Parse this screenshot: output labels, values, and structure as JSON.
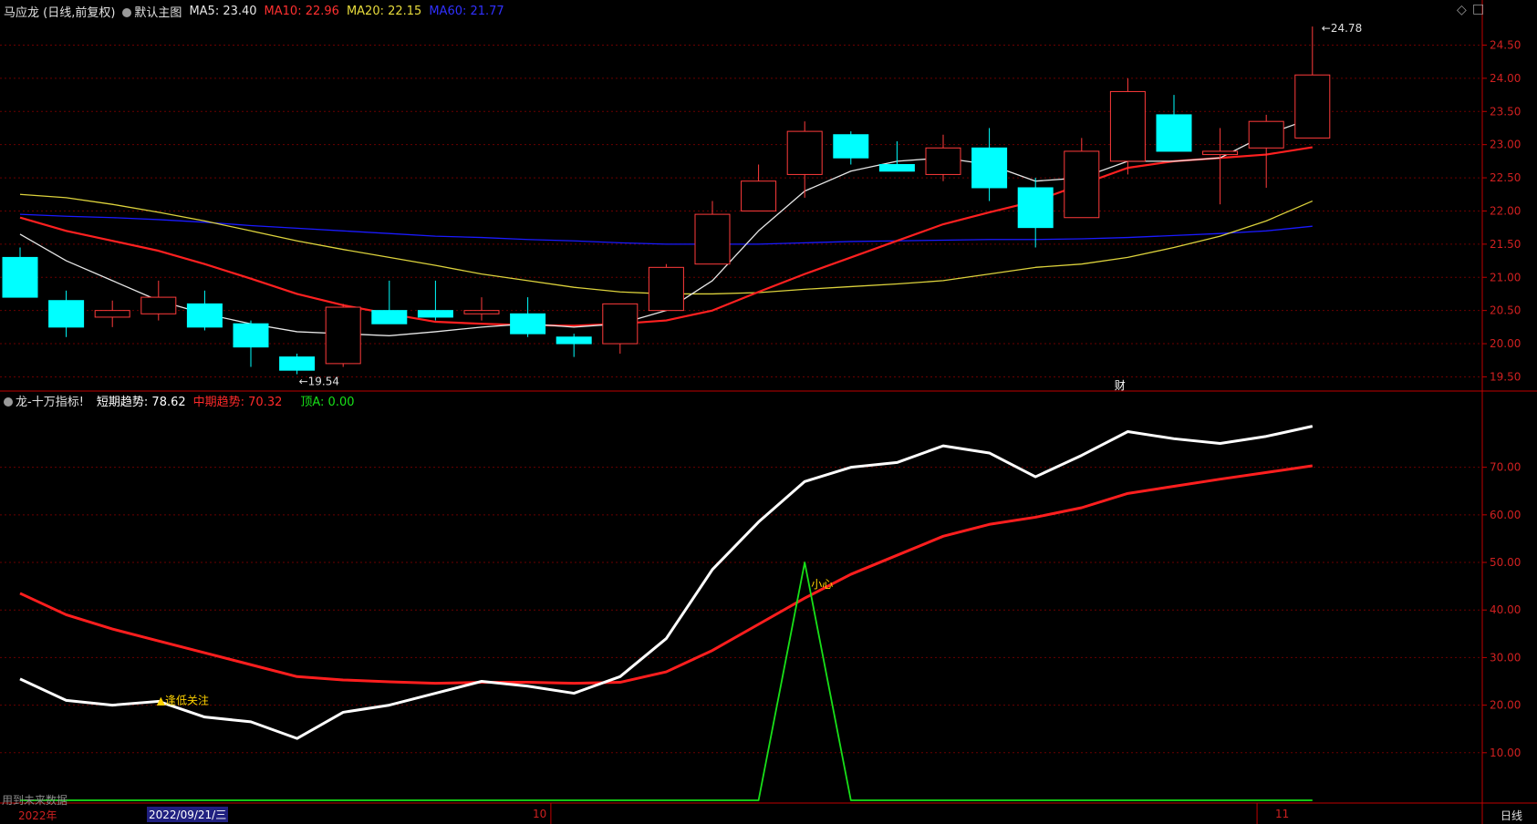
{
  "upper_header": {
    "title": "马应龙 (日线,前复权)",
    "main_chart": "默认主图",
    "ma5": "MA5: 23.40",
    "ma10": "MA10: 22.96",
    "ma20": "MA20: 22.15",
    "ma60": "MA60: 21.77"
  },
  "lower_header": {
    "title": "龙-十万指标!",
    "short": "短期趋势: 78.62",
    "mid": "中期趋势: 70.32",
    "top": "顶A: 0.00"
  },
  "colors": {
    "background": "#000000",
    "up": "#ff3b3b",
    "down": "#00ffff",
    "ma5": "#e6e6e6",
    "ma10": "#ff2020",
    "ma20": "#dcd23c",
    "ma60": "#1a1aff",
    "short_trend": "#ffffff",
    "mid_trend": "#ff1e1e",
    "top_a": "#18e018",
    "axis": "#c00000",
    "grid": "#6a0000"
  },
  "footer": {
    "future_data_note": "用到未来数据",
    "year_label": "2022年",
    "cursor_date": "2022/09/21/三",
    "month_oct": "10",
    "month_nov": "11",
    "period": "日线"
  },
  "controls": {
    "diamond_icon": "◇",
    "box_icon": "□"
  },
  "chart_data": [
    {
      "type": "candlestick",
      "title": "马应龙 (日线,前复权)",
      "y_ticks": [
        19.5,
        20.0,
        20.5,
        21.0,
        21.5,
        22.0,
        22.5,
        23.0,
        23.5,
        24.0,
        24.5
      ],
      "ylim": [
        19.3,
        24.85
      ],
      "candles": [
        {
          "o": 21.3,
          "h": 21.45,
          "l": 20.7,
          "c": 20.7
        },
        {
          "o": 20.65,
          "h": 20.8,
          "l": 20.1,
          "c": 20.25
        },
        {
          "o": 20.4,
          "h": 20.65,
          "l": 20.25,
          "c": 20.5
        },
        {
          "o": 20.45,
          "h": 20.95,
          "l": 20.35,
          "c": 20.7
        },
        {
          "o": 20.6,
          "h": 20.8,
          "l": 20.2,
          "c": 20.25
        },
        {
          "o": 20.3,
          "h": 20.35,
          "l": 19.65,
          "c": 19.95
        },
        {
          "o": 19.8,
          "h": 19.85,
          "l": 19.54,
          "c": 19.6
        },
        {
          "o": 19.7,
          "h": 20.6,
          "l": 19.65,
          "c": 20.55
        },
        {
          "o": 20.5,
          "h": 20.95,
          "l": 20.3,
          "c": 20.3
        },
        {
          "o": 20.5,
          "h": 20.95,
          "l": 20.35,
          "c": 20.4
        },
        {
          "o": 20.45,
          "h": 20.7,
          "l": 20.35,
          "c": 20.5
        },
        {
          "o": 20.45,
          "h": 20.7,
          "l": 20.1,
          "c": 20.15
        },
        {
          "o": 20.1,
          "h": 20.15,
          "l": 19.8,
          "c": 20.0
        },
        {
          "o": 20.0,
          "h": 20.55,
          "l": 19.85,
          "c": 20.6
        },
        {
          "o": 20.5,
          "h": 21.2,
          "l": 20.5,
          "c": 21.15
        },
        {
          "o": 21.2,
          "h": 22.15,
          "l": 21.2,
          "c": 21.95
        },
        {
          "o": 22.0,
          "h": 22.7,
          "l": 22.0,
          "c": 22.45
        },
        {
          "o": 22.55,
          "h": 23.35,
          "l": 22.2,
          "c": 23.2
        },
        {
          "o": 23.15,
          "h": 23.2,
          "l": 22.7,
          "c": 22.8
        },
        {
          "o": 22.7,
          "h": 23.05,
          "l": 22.6,
          "c": 22.6
        },
        {
          "o": 22.55,
          "h": 23.15,
          "l": 22.45,
          "c": 22.95
        },
        {
          "o": 22.95,
          "h": 23.25,
          "l": 22.15,
          "c": 22.35
        },
        {
          "o": 22.35,
          "h": 22.5,
          "l": 21.45,
          "c": 21.75
        },
        {
          "o": 21.9,
          "h": 23.1,
          "l": 21.9,
          "c": 22.9
        },
        {
          "o": 22.75,
          "h": 24.0,
          "l": 22.55,
          "c": 23.8
        },
        {
          "o": 23.45,
          "h": 23.75,
          "l": 22.9,
          "c": 22.9
        },
        {
          "o": 22.85,
          "h": 23.25,
          "l": 22.1,
          "c": 22.9
        },
        {
          "o": 22.95,
          "h": 23.45,
          "l": 22.35,
          "c": 23.35
        },
        {
          "o": 23.1,
          "h": 24.78,
          "l": 23.1,
          "c": 24.05
        }
      ],
      "ma5": [
        21.65,
        21.25,
        20.95,
        20.65,
        20.45,
        20.3,
        20.18,
        20.15,
        20.12,
        20.18,
        20.25,
        20.3,
        20.25,
        20.3,
        20.5,
        20.95,
        21.7,
        22.3,
        22.6,
        22.75,
        22.8,
        22.7,
        22.45,
        22.5,
        22.75,
        22.75,
        22.8,
        23.15,
        23.4
      ],
      "ma10": [
        21.9,
        21.7,
        21.55,
        21.4,
        21.2,
        20.98,
        20.75,
        20.58,
        20.45,
        20.33,
        20.3,
        20.28,
        20.27,
        20.3,
        20.35,
        20.5,
        20.78,
        21.05,
        21.3,
        21.55,
        21.8,
        21.98,
        22.15,
        22.4,
        22.65,
        22.75,
        22.8,
        22.85,
        22.96
      ],
      "ma20": [
        22.25,
        22.2,
        22.1,
        21.98,
        21.85,
        21.7,
        21.55,
        21.42,
        21.3,
        21.18,
        21.05,
        20.95,
        20.85,
        20.78,
        20.75,
        20.75,
        20.77,
        20.82,
        20.86,
        20.9,
        20.95,
        21.05,
        21.15,
        21.2,
        21.3,
        21.45,
        21.62,
        21.85,
        22.15
      ],
      "ma60": [
        21.95,
        21.92,
        21.9,
        21.87,
        21.83,
        21.78,
        21.74,
        21.7,
        21.66,
        21.62,
        21.6,
        21.57,
        21.55,
        21.52,
        21.5,
        21.5,
        21.5,
        21.52,
        21.54,
        21.55,
        21.56,
        21.57,
        21.57,
        21.58,
        21.6,
        21.63,
        21.66,
        21.7,
        21.77
      ],
      "annotations": [
        {
          "text": "←19.54",
          "index": 6,
          "price": 19.54
        },
        {
          "text": "←24.78",
          "index": 28,
          "price": 24.78
        },
        {
          "text": "财",
          "index": 23
        }
      ]
    },
    {
      "type": "line",
      "title": "龙-十万指标!",
      "y_ticks": [
        10,
        20,
        30,
        40,
        50,
        60,
        70
      ],
      "ylim": [
        0,
        82
      ],
      "series": [
        {
          "name": "短期趋势",
          "values": [
            25.5,
            21.0,
            20.0,
            20.8,
            17.5,
            16.5,
            13.0,
            18.5,
            20.0,
            22.5,
            25.0,
            24.0,
            22.5,
            26.0,
            34.0,
            48.5,
            58.5,
            67.0,
            70.0,
            71.0,
            74.5,
            73.0,
            68.0,
            72.5,
            77.5,
            76.0,
            75.0,
            76.5,
            78.62
          ]
        },
        {
          "name": "中期趋势",
          "values": [
            43.5,
            39.0,
            36.0,
            33.5,
            31.0,
            28.5,
            26.0,
            25.3,
            24.9,
            24.6,
            24.8,
            24.8,
            24.6,
            24.8,
            27.0,
            31.5,
            37.0,
            42.5,
            47.5,
            51.5,
            55.5,
            58.0,
            59.5,
            61.5,
            64.5,
            66.0,
            67.5,
            68.9,
            70.32
          ]
        },
        {
          "name": "顶A",
          "values": [
            0,
            0,
            0,
            0,
            0,
            0,
            0,
            0,
            0,
            0,
            0,
            0,
            0,
            0,
            0,
            0,
            0,
            50,
            0,
            0,
            0,
            0,
            0,
            0,
            0,
            0,
            0,
            0,
            0
          ]
        }
      ],
      "annotations": [
        {
          "text": "▲逢低关注",
          "index": 3,
          "value": 20.8
        },
        {
          "text": "小心",
          "index": 17,
          "value": 45
        }
      ]
    }
  ]
}
